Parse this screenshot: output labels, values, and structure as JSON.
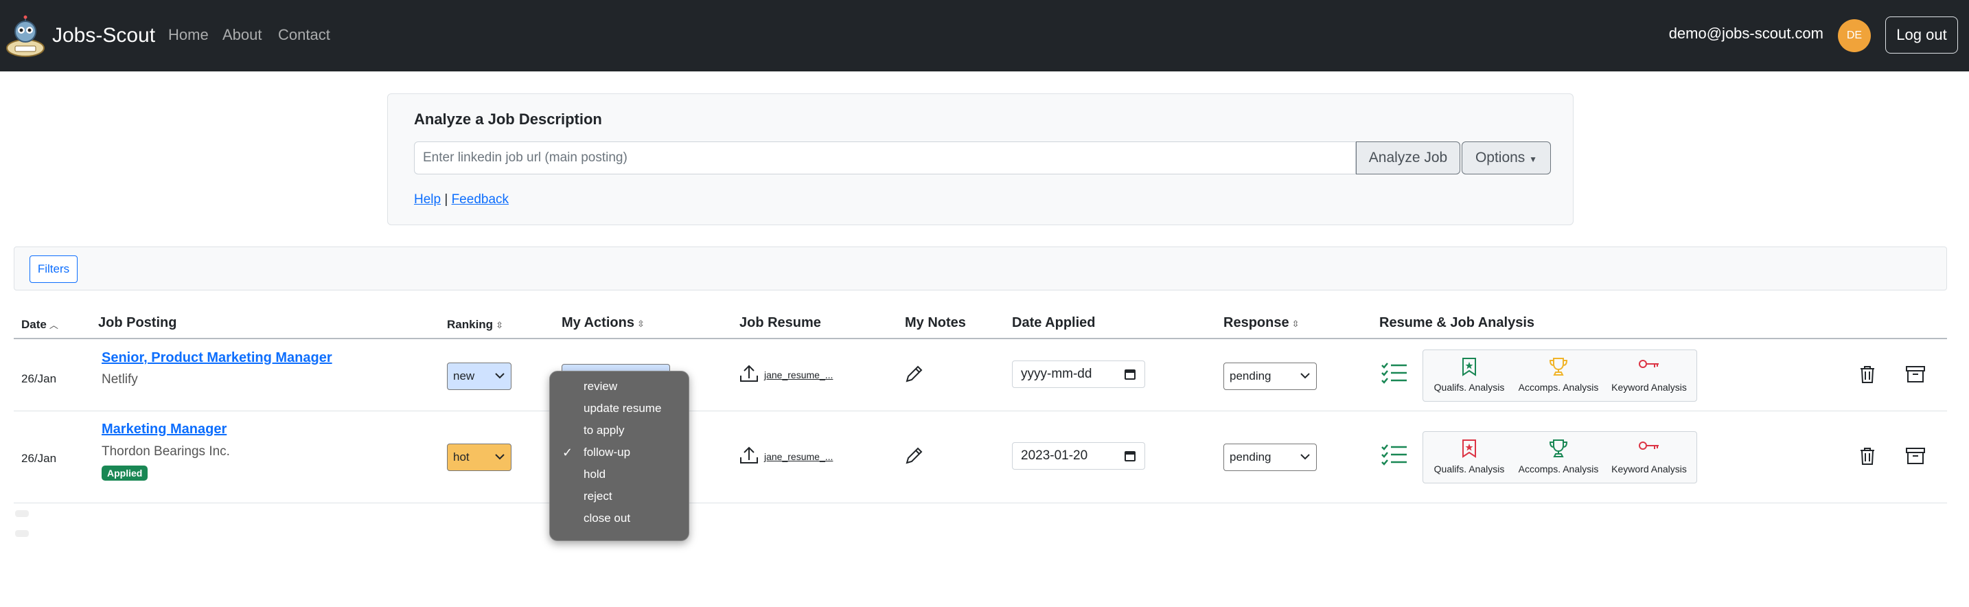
{
  "navbar": {
    "brand": "Jobs-Scout",
    "links": [
      "Home",
      "About",
      "Contact"
    ],
    "email": "demo@jobs-scout.com",
    "avatar_initials": "DE",
    "logout": "Log out"
  },
  "analyze": {
    "title": "Analyze a Job Description",
    "placeholder": "Enter linkedin job url (main posting)",
    "analyze_button": "Analyze Job",
    "options_button": "Options",
    "help": "Help",
    "separator": "|",
    "feedback": "Feedback"
  },
  "filters": {
    "button": "Filters"
  },
  "table": {
    "headers": {
      "date": "Date",
      "job_posting": "Job Posting",
      "ranking": "Ranking",
      "my_actions": "My Actions",
      "job_resume": "Job Resume",
      "my_notes": "My Notes",
      "date_applied": "Date Applied",
      "response": "Response",
      "analysis": "Resume & Job Analysis"
    },
    "rows": [
      {
        "date": "26/Jan",
        "title": "Senior, Product Marketing Manager",
        "company": "Netlify",
        "ranking": "new",
        "resume": "jane_resume_...",
        "date_applied_placeholder": "yyyy-mm-dd",
        "response": "pending"
      },
      {
        "date": "26/Jan",
        "title": "Marketing Manager",
        "company": "Thordon Bearings Inc.",
        "badge": "Applied",
        "ranking": "hot",
        "resume": "jane_resume_...",
        "date_applied": "2023-01-20",
        "response": "pending"
      }
    ],
    "analysis_labels": {
      "qualifs": "Qualifs. Analysis",
      "accomps": "Accomps. Analysis",
      "keyword": "Keyword Analysis"
    }
  },
  "actions_dropdown": {
    "items": [
      "review",
      "update resume",
      "to apply",
      "follow-up",
      "hold",
      "reject",
      "close out"
    ],
    "selected": "follow-up",
    "check": "✓"
  },
  "colors": {
    "navbar": "#212529",
    "link": "#0d6efd",
    "green": "#198754",
    "red": "#dc3545",
    "gold": "#f0b429",
    "rank_new": "#cfe2ff",
    "rank_hot": "#f7c15f"
  }
}
